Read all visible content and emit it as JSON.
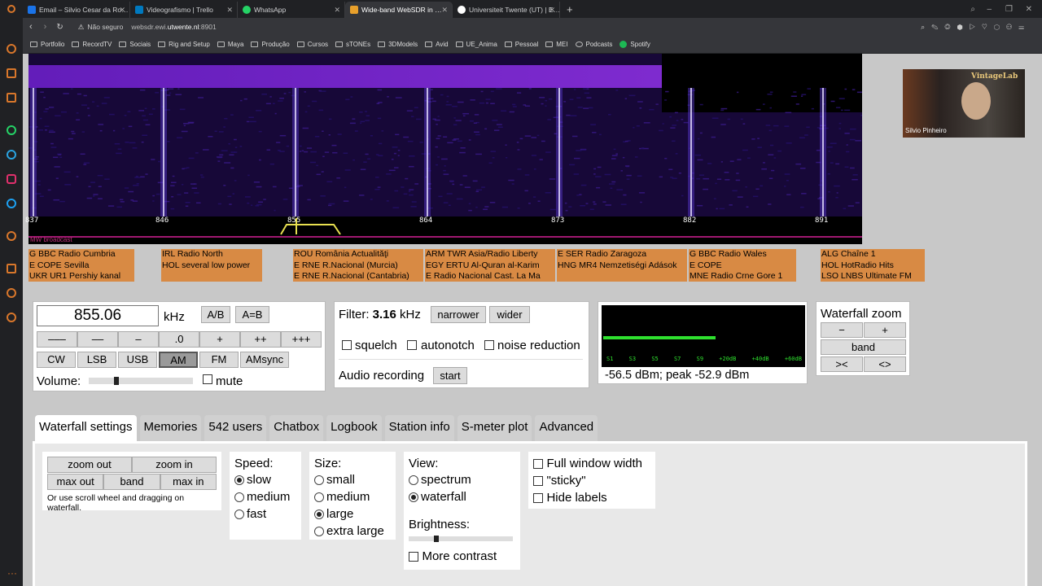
{
  "browser": {
    "tabs": [
      {
        "label": "Email – Silvio Cesar da Ro…",
        "color": "#1a73e8"
      },
      {
        "label": "Videografismo | Trello",
        "color": "#0079bf"
      },
      {
        "label": "WhatsApp",
        "color": "#25d366"
      },
      {
        "label": "Wide-band WebSDR in …",
        "color": "#e8a02b"
      },
      {
        "label": "Universiteit Twente (UT) | E…",
        "color": "#444"
      }
    ],
    "security": "Não seguro",
    "url_prefix": "websdr.ewi.",
    "url_domain": "utwente.nl",
    "url_suffix": ":8901",
    "bookmarks": [
      "Portfolio",
      "RecordTV",
      "Sociais",
      "Rig and Setup",
      "Maya",
      "Produção",
      "Cursos",
      "sTONEs",
      "3DModels",
      "Avid",
      "UE_Anima",
      "Pessoal",
      "MEI",
      "Podcasts",
      "Spotify"
    ]
  },
  "waterfall": {
    "ticks": [
      "837",
      "846",
      "855",
      "864",
      "873",
      "882",
      "891"
    ],
    "band_label": "MW broadcast"
  },
  "station_labels": [
    [
      "G BBC Radio Cumbria",
      "E COPE Sevilla",
      "UKR UR1 Pershiy kanal"
    ],
    [
      "IRL Radio North",
      "HOL several low power",
      ""
    ],
    [
      "ROU România Actualităţi",
      "E RNE R.Nacional (Murcia)",
      "E RNE R.Nacional (Cantabria)"
    ],
    [
      "ARM TWR Asia/Radio Liberty",
      "EGY ERTU Al-Quran al-Karim",
      "E Radio Nacional Cast. La Ma"
    ],
    [
      "E SER Radio Zaragoza",
      "HNG MR4 Nemzetiségi Adások",
      ""
    ],
    [
      "G BBC Radio Wales",
      "E COPE",
      "MNE Radio Crne Gore 1"
    ],
    [
      "ALG Chaîne 1",
      "HOL HotRadio Hits",
      "LSO LNBS Ultimate FM"
    ]
  ],
  "tuner": {
    "frequency": "855.06",
    "unit": "kHz",
    "ab": "A/B",
    "aeqb": "A=B",
    "steps": [
      "–––",
      "––",
      "–",
      ".0",
      "+",
      "++",
      "+++"
    ],
    "modes": [
      "CW",
      "LSB",
      "USB",
      "AM",
      "FM",
      "AMsync"
    ],
    "active_mode": "AM",
    "volume_label": "Volume:",
    "volume_level": 0.25,
    "mute_label": "mute"
  },
  "filter": {
    "label": "Filter:",
    "value": "3.16",
    "unit": "kHz",
    "narrower": "narrower",
    "wider": "wider",
    "squelch": "squelch",
    "autonotch": "autonotch",
    "noise_reduction": "noise reduction",
    "recording_label": "Audio recording",
    "start": "start"
  },
  "smeter": {
    "scale": [
      "S1",
      "S3",
      "S5",
      "S7",
      "S9",
      "+20dB",
      "+40dB",
      "+60dB"
    ],
    "reading": "-56.5 dBm; peak  -52.9 dBm",
    "level": 0.56
  },
  "wfzoom": {
    "title": "Waterfall zoom",
    "minus": "−",
    "plus": "+",
    "band": "band",
    "in": "><",
    "out": "<>"
  },
  "video": {
    "overlay": "Silvio Pinheiro",
    "brand": "VintageLab"
  },
  "panel_tabs": [
    "Waterfall settings",
    "Memories",
    "542 users",
    "Chatbox",
    "Logbook",
    "Station info",
    "S-meter plot",
    "Advanced"
  ],
  "settings": {
    "zoom_out": "zoom out",
    "zoom_in": "zoom in",
    "max_out": "max out",
    "band": "band",
    "max_in": "max in",
    "hint": "Or use scroll wheel and dragging on waterfall.",
    "speed_title": "Speed:",
    "speed": [
      "slow",
      "medium",
      "fast"
    ],
    "size_title": "Size:",
    "size": [
      "small",
      "medium",
      "large",
      "extra large"
    ],
    "view_title": "View:",
    "view": [
      "spectrum",
      "waterfall"
    ],
    "brightness_title": "Brightness:",
    "brightness_level": 0.25,
    "more_contrast": "More contrast",
    "full_width": "Full window width",
    "sticky": "\"sticky\"",
    "hide_labels": "Hide labels"
  }
}
